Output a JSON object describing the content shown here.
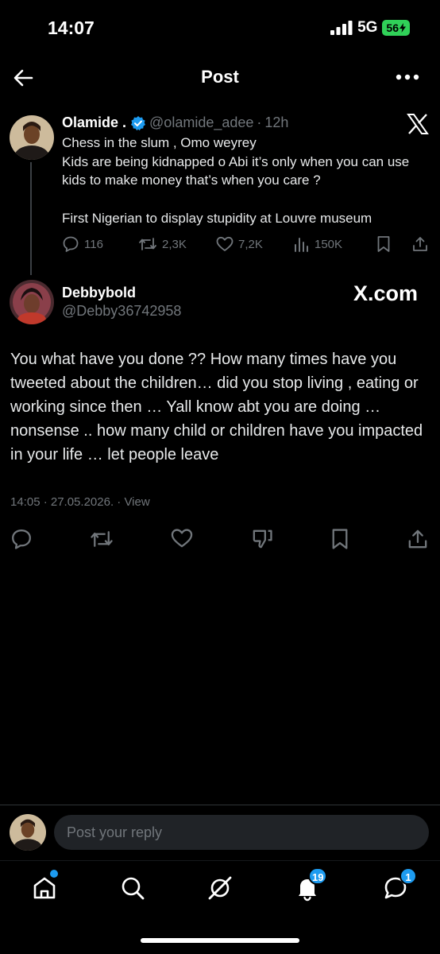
{
  "status_bar": {
    "time": "14:07",
    "network": "5G",
    "battery": "56"
  },
  "header": {
    "title": "Post"
  },
  "quoted_post": {
    "name": "Olamide .",
    "handle": "@olamide_adee",
    "time": "12h",
    "lines": [
      "Chess in the slum , Omo weyrey",
      "Kids are being kidnapped o Abi it’s only when you can use kids to make money that’s when you care ?",
      "First Nigerian to display stupidity at Louvre museum"
    ],
    "stats": {
      "replies": "116",
      "reposts": "2,3K",
      "likes": "7,2K",
      "views": "150K"
    }
  },
  "reply_post": {
    "name": "Debbybold",
    "handle": "@Debby36742958",
    "watermark": "X.com",
    "text": "You what have you done ?? How many times have you tweeted about the children… did you stop living  , eating or working since then … Yall know abt you are doing … nonsense .. how many child  or children have you impacted in your life … let people leave",
    "meta": "14:05 · 27.05.2026. · View"
  },
  "reply_bar": {
    "placeholder": "Post your reply"
  },
  "tabbar": {
    "notifications_badge": "19",
    "messages_badge": "1"
  },
  "colors": {
    "background": "#000000",
    "accent": "#1d9bf0",
    "verified": "#1d9bf0",
    "battery": "#30d158",
    "muted": "#71767b"
  }
}
